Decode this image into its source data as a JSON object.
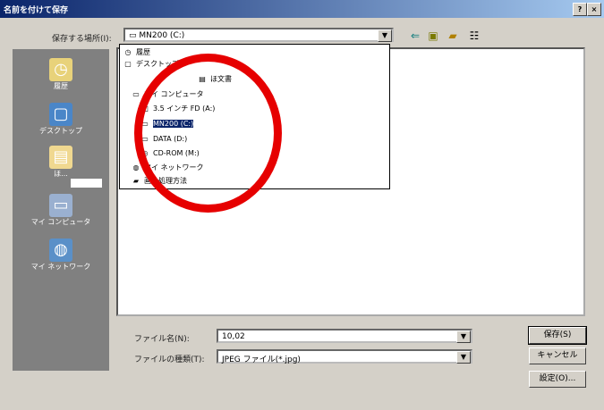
{
  "window": {
    "title": "名前を付けて保存",
    "help_label": "?",
    "close_label": "×"
  },
  "save_in": {
    "label": "保存する場所(I):",
    "value": "MN200 (C:)"
  },
  "toolbar": {
    "back_icon": "back-arrow-icon",
    "up_icon": "up-folder-icon",
    "new_folder_icon": "new-folder-icon",
    "view_icon": "view-menu-icon"
  },
  "places": [
    {
      "label": "履歴",
      "icon": "history-icon"
    },
    {
      "label": "デスクトップ",
      "icon": "desktop-icon"
    },
    {
      "label": "ほ...",
      "icon": "my-documents-icon"
    },
    {
      "label": "マイ コンピュータ",
      "icon": "my-computer-icon"
    },
    {
      "label": "マイ ネットワーク",
      "icon": "network-icon"
    }
  ],
  "dropdown": {
    "items": [
      {
        "label": "履歴",
        "icon": "history-icon",
        "selected": false
      },
      {
        "label": "デスクトップ",
        "icon": "desktop-icon",
        "selected": false
      },
      {
        "label": "ほ文書",
        "icon": "my-documents-icon",
        "selected": false
      },
      {
        "label": "マイ コンピュータ",
        "icon": "my-computer-icon",
        "selected": false
      },
      {
        "label": "3.5 インチ FD (A:)",
        "icon": "floppy-icon",
        "selected": false
      },
      {
        "label": "MN200 (C:)",
        "icon": "hard-drive-icon",
        "selected": true
      },
      {
        "label": "DATA (D:)",
        "icon": "hard-drive-icon",
        "selected": false
      },
      {
        "label": "CD-ROM (M:)",
        "icon": "cdrom-icon",
        "selected": false
      },
      {
        "label": "マイ ネットワーク",
        "icon": "network-icon",
        "selected": false
      },
      {
        "label": "画像処理方法",
        "icon": "folder-icon",
        "selected": false
      }
    ]
  },
  "file_name": {
    "label": "ファイル名(N):",
    "value": "10,02"
  },
  "file_type": {
    "label": "ファイルの種類(T):",
    "value": "JPEG ファイル(*.jpg)"
  },
  "buttons": {
    "save": "保存(S)",
    "cancel": "キャンセル",
    "settings": "設定(O)..."
  },
  "annotation": {
    "circle_color": "#e60000"
  }
}
